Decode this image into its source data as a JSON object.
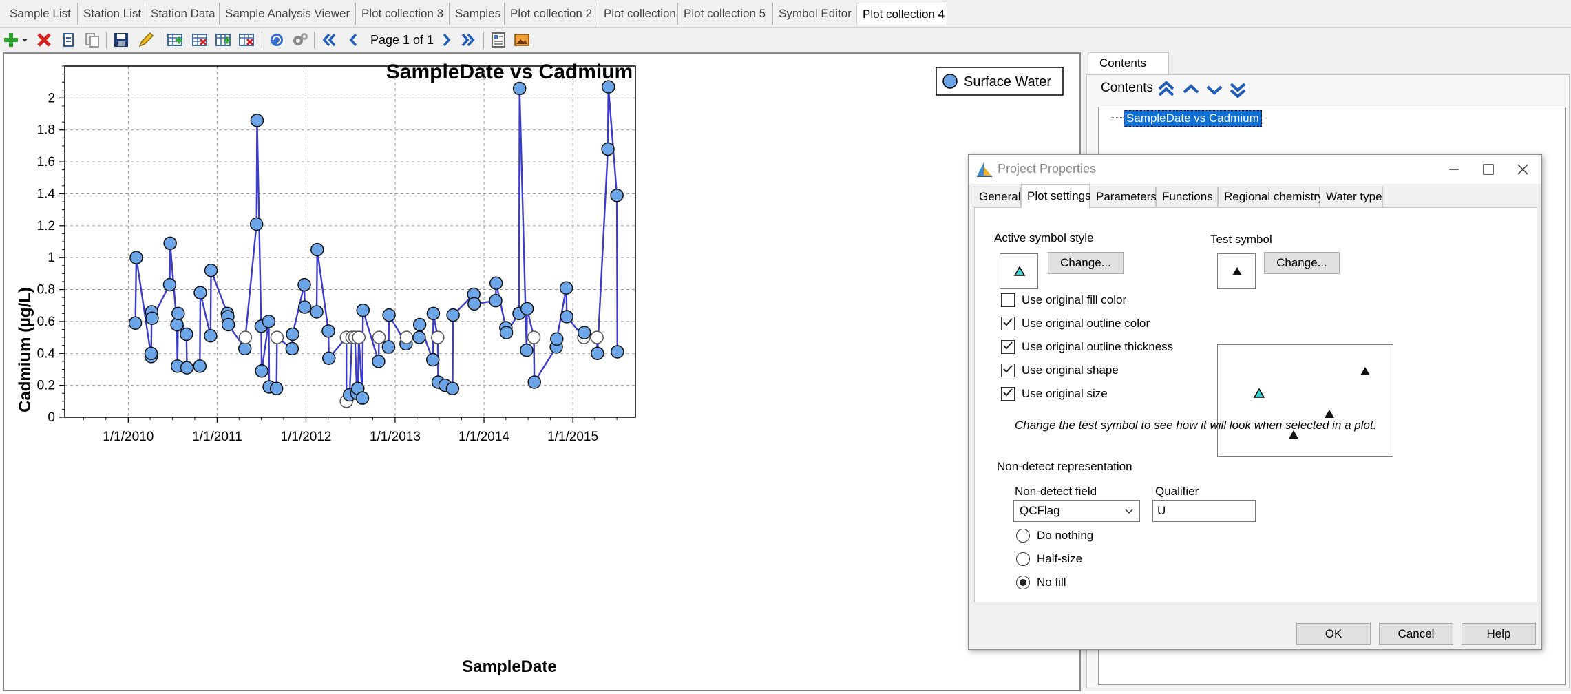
{
  "tabs": [
    {
      "label": "Sample List"
    },
    {
      "label": "Station List"
    },
    {
      "label": "Station Data"
    },
    {
      "label": "Sample Analysis Viewer"
    },
    {
      "label": "Plot collection 3"
    },
    {
      "label": "Samples"
    },
    {
      "label": "Plot collection 2"
    },
    {
      "label": "Plot collection"
    },
    {
      "label": "Plot collection 5"
    },
    {
      "label": "Symbol Editor"
    },
    {
      "label": "Plot collection 4"
    }
  ],
  "toolbar": {
    "page_info": "Page 1 of 1",
    "icons": [
      "add-icon",
      "delete-icon",
      "copy-icon",
      "paste-icon",
      "save-icon",
      "edit-icon",
      "add-row-icon",
      "delete-row-icon",
      "add-column-icon",
      "delete-column-icon",
      "refresh-icon",
      "settings-icon",
      "first-page-icon",
      "previous-page-icon",
      "next-page-icon",
      "last-page-icon",
      "layout-icon",
      "image-icon"
    ]
  },
  "chart_data": {
    "type": "scatter",
    "title": "SampleDate vs Cadmium",
    "xlabel": "SampleDate",
    "ylabel": "Cadmium (µg/L)",
    "xlim": [
      "2009-04-15",
      "2015-09-15"
    ],
    "ylim": [
      0,
      2.2
    ],
    "x_ticks": [
      "1/1/2010",
      "1/1/2011",
      "1/1/2012",
      "1/1/2013",
      "1/1/2014",
      "1/1/2015"
    ],
    "y_ticks": [
      "0",
      "0.2",
      "0.4",
      "0.6",
      "0.8",
      "1",
      "1.2",
      "1.4",
      "1.6",
      "1.8",
      "2"
    ],
    "grid": true,
    "legend_position": "top-right",
    "series": [
      {
        "name": "Surface Water",
        "marker_color": "#6ca6e8",
        "line_color": "#3c3ccc",
        "points": [
          {
            "x": "2010-01-30",
            "y": 0.59
          },
          {
            "x": "2010-02-03",
            "y": 1.0
          },
          {
            "x": "2010-04-05",
            "y": 0.38
          },
          {
            "x": "2010-04-05",
            "y": 0.4
          },
          {
            "x": "2010-04-07",
            "y": 0.66
          },
          {
            "x": "2010-04-09",
            "y": 0.62
          },
          {
            "x": "2010-06-20",
            "y": 0.83
          },
          {
            "x": "2010-06-22",
            "y": 1.09
          },
          {
            "x": "2010-07-20",
            "y": 0.58
          },
          {
            "x": "2010-07-22",
            "y": 0.32
          },
          {
            "x": "2010-07-25",
            "y": 0.65
          },
          {
            "x": "2010-08-28",
            "y": 0.52
          },
          {
            "x": "2010-08-30",
            "y": 0.31
          },
          {
            "x": "2010-10-22",
            "y": 0.32
          },
          {
            "x": "2010-10-24",
            "y": 0.78
          },
          {
            "x": "2010-12-05",
            "y": 0.51
          },
          {
            "x": "2010-12-07",
            "y": 0.92
          },
          {
            "x": "2011-02-12",
            "y": 0.65
          },
          {
            "x": "2011-02-14",
            "y": 0.63
          },
          {
            "x": "2011-02-16",
            "y": 0.58
          },
          {
            "x": "2011-04-25",
            "y": 0.43
          },
          {
            "x": "2011-04-27",
            "y": 0.5,
            "nd": true
          },
          {
            "x": "2011-06-12",
            "y": 1.21
          },
          {
            "x": "2011-06-14",
            "y": 1.86
          },
          {
            "x": "2011-07-01",
            "y": 0.57
          },
          {
            "x": "2011-07-03",
            "y": 0.29
          },
          {
            "x": "2011-08-01",
            "y": 0.6
          },
          {
            "x": "2011-08-03",
            "y": 0.19
          },
          {
            "x": "2011-09-02",
            "y": 0.18
          },
          {
            "x": "2011-09-04",
            "y": 0.5,
            "nd": true
          },
          {
            "x": "2011-11-05",
            "y": 0.43
          },
          {
            "x": "2011-11-07",
            "y": 0.52
          },
          {
            "x": "2011-12-25",
            "y": 0.83
          },
          {
            "x": "2011-12-27",
            "y": 0.69
          },
          {
            "x": "2012-02-14",
            "y": 0.66
          },
          {
            "x": "2012-02-16",
            "y": 1.05
          },
          {
            "x": "2012-04-02",
            "y": 0.54
          },
          {
            "x": "2012-04-04",
            "y": 0.37
          },
          {
            "x": "2012-06-15",
            "y": 0.5,
            "nd": true
          },
          {
            "x": "2012-06-15",
            "y": 0.1,
            "nd": true
          },
          {
            "x": "2012-06-28",
            "y": 0.14
          },
          {
            "x": "2012-07-08",
            "y": 0.5,
            "nd": true
          },
          {
            "x": "2012-07-20",
            "y": 0.5,
            "nd": true
          },
          {
            "x": "2012-07-28",
            "y": 0.15
          },
          {
            "x": "2012-08-01",
            "y": 0.18
          },
          {
            "x": "2012-08-05",
            "y": 0.5,
            "nd": true
          },
          {
            "x": "2012-08-20",
            "y": 0.12
          },
          {
            "x": "2012-08-22",
            "y": 0.67
          },
          {
            "x": "2012-10-25",
            "y": 0.35
          },
          {
            "x": "2012-10-27",
            "y": 0.5,
            "nd": true
          },
          {
            "x": "2012-12-05",
            "y": 0.44
          },
          {
            "x": "2012-12-07",
            "y": 0.64
          },
          {
            "x": "2013-02-15",
            "y": 0.46
          },
          {
            "x": "2013-02-17",
            "y": 0.5,
            "nd": true
          },
          {
            "x": "2013-04-10",
            "y": 0.5
          },
          {
            "x": "2013-04-12",
            "y": 0.58
          },
          {
            "x": "2013-06-05",
            "y": 0.36
          },
          {
            "x": "2013-06-07",
            "y": 0.65
          },
          {
            "x": "2013-06-25",
            "y": 0.5,
            "nd": true
          },
          {
            "x": "2013-06-27",
            "y": 0.22
          },
          {
            "x": "2013-07-25",
            "y": 0.2
          },
          {
            "x": "2013-08-25",
            "y": 0.18
          },
          {
            "x": "2013-08-27",
            "y": 0.64
          },
          {
            "x": "2013-11-20",
            "y": 0.77
          },
          {
            "x": "2013-11-22",
            "y": 0.71
          },
          {
            "x": "2014-02-18",
            "y": 0.73
          },
          {
            "x": "2014-02-20",
            "y": 0.84
          },
          {
            "x": "2014-04-01",
            "y": 0.56
          },
          {
            "x": "2014-04-03",
            "y": 0.53
          },
          {
            "x": "2014-05-25",
            "y": 0.65
          },
          {
            "x": "2014-05-27",
            "y": 2.06
          },
          {
            "x": "2014-06-25",
            "y": 0.42
          },
          {
            "x": "2014-06-27",
            "y": 0.68
          },
          {
            "x": "2014-07-25",
            "y": 0.5,
            "nd": true
          },
          {
            "x": "2014-07-27",
            "y": 0.22
          },
          {
            "x": "2014-10-25",
            "y": 0.44
          },
          {
            "x": "2014-10-27",
            "y": 0.49
          },
          {
            "x": "2014-12-05",
            "y": 0.81
          },
          {
            "x": "2014-12-07",
            "y": 0.63
          },
          {
            "x": "2015-02-15",
            "y": 0.5,
            "nd": true
          },
          {
            "x": "2015-02-17",
            "y": 0.53
          },
          {
            "x": "2015-04-10",
            "y": 0.5,
            "nd": true
          },
          {
            "x": "2015-04-12",
            "y": 0.4
          },
          {
            "x": "2015-05-25",
            "y": 1.68
          },
          {
            "x": "2015-05-27",
            "y": 2.07
          },
          {
            "x": "2015-07-01",
            "y": 1.39
          },
          {
            "x": "2015-07-03",
            "y": 0.41
          }
        ]
      }
    ]
  },
  "contents": {
    "tab_label": "Contents",
    "header_label": "Contents",
    "tree_item": "SampleDate vs Cadmium"
  },
  "dialog": {
    "title": "Project Properties",
    "tabs": [
      "General",
      "Plot settings",
      "Parameters",
      "Functions",
      "Regional chemistry",
      "Water type"
    ],
    "active_tab": "Plot settings",
    "active_symbol_label": "Active symbol style",
    "test_symbol_label": "Test symbol",
    "change_label": "Change...",
    "active_symbol_color": "#30d0d0",
    "test_symbol_color": "#111111",
    "checkboxes": [
      {
        "label": "Use original fill color",
        "checked": false
      },
      {
        "label": "Use original outline color",
        "checked": true
      },
      {
        "label": "Use original outline thickness",
        "checked": true
      },
      {
        "label": "Use original shape",
        "checked": true
      },
      {
        "label": "Use original size",
        "checked": true
      }
    ],
    "hint": "Change the test symbol to see how it will look when selected in a plot.",
    "nondetect": {
      "group_label": "Non-detect representation",
      "field_label": "Non-detect field",
      "field_value": "QCFlag",
      "qualifier_label": "Qualifier",
      "qualifier_value": "U",
      "options": [
        {
          "label": "Do nothing",
          "selected": false
        },
        {
          "label": "Half-size",
          "selected": false
        },
        {
          "label": "No fill",
          "selected": true
        }
      ]
    },
    "buttons": {
      "ok": "OK",
      "cancel": "Cancel",
      "help": "Help"
    }
  }
}
